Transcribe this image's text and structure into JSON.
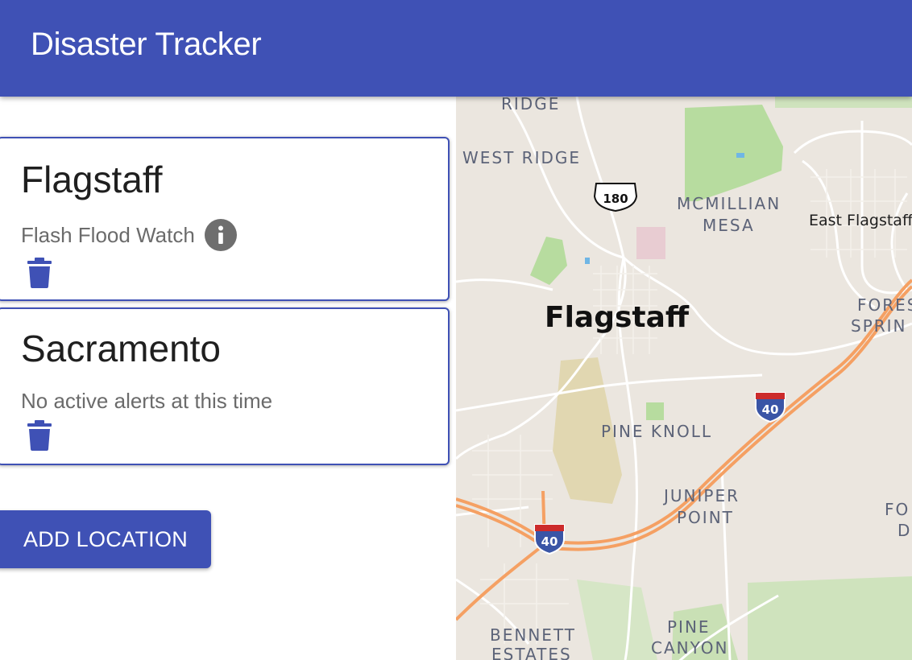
{
  "app": {
    "title": "Disaster Tracker"
  },
  "locations": [
    {
      "name": "Flagstaff",
      "status": "Flash Flood Watch",
      "has_info_icon": true
    },
    {
      "name": "Sacramento",
      "status": "No active alerts at this time",
      "has_info_icon": false
    }
  ],
  "actions": {
    "add_location_label": "ADD LOCATION"
  },
  "map": {
    "city_label": "Flagstaff",
    "area_labels": {
      "ridge": "RIDGE",
      "west_ridge": "WEST RIDGE",
      "mcmillian_1": "MCMILLIAN",
      "mcmillian_2": "MESA",
      "east_flagstaff": "East Flagstaff",
      "forest_springs_1": "FORES",
      "forest_springs_2": "SPRIN",
      "pine_knoll": "PINE KNOLL",
      "juniper_1": "JUNIPER",
      "juniper_2": "POINT",
      "fort_1": "FO",
      "fort_2": "D",
      "bennett_1": "BENNETT",
      "bennett_2": "ESTATES",
      "pine_canyon_1": "PINE",
      "pine_canyon_2": "CANYON"
    },
    "shields": {
      "us_180": "180",
      "i40_east": "40",
      "i40_west": "40"
    }
  },
  "colors": {
    "primary": "#3f51b5",
    "app_bar_text": "#ffffff",
    "icon_gray": "#6e6e6e",
    "map_background": "#ebe6df",
    "interstate": "#f5a063",
    "park_green": "#b7dc9f"
  },
  "icons": {
    "info": "info-circle-icon",
    "delete": "trash-icon"
  }
}
